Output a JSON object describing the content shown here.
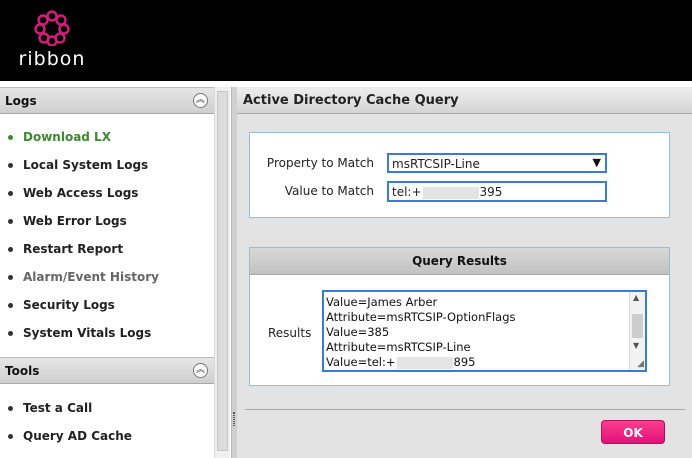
{
  "brand": {
    "name": "ribbon",
    "accent": "#e0127a"
  },
  "sidebar": {
    "sections": [
      {
        "title": "Logs",
        "items": [
          {
            "label": "Download LX",
            "state": "active"
          },
          {
            "label": "Local System Logs",
            "state": ""
          },
          {
            "label": "Web Access Logs",
            "state": ""
          },
          {
            "label": "Web Error Logs",
            "state": ""
          },
          {
            "label": "Restart Report",
            "state": ""
          },
          {
            "label": "Alarm/Event History",
            "state": "muted"
          },
          {
            "label": "Security Logs",
            "state": ""
          },
          {
            "label": "System Vitals Logs",
            "state": ""
          }
        ]
      },
      {
        "title": "Tools",
        "items": [
          {
            "label": "Test a Call",
            "state": ""
          },
          {
            "label": "Query AD Cache",
            "state": ""
          }
        ]
      }
    ]
  },
  "main": {
    "title": "Active Directory Cache Query",
    "property_label": "Property to Match",
    "property_value": "msRTCSIP-Line",
    "value_label": "Value to Match",
    "value_prefix": "tel:+",
    "value_suffix": "395",
    "results_title": "Query Results",
    "results_label": "Results",
    "results_lines": [
      "Value=James Arber",
      "Attribute=msRTCSIP-OptionFlags",
      "Value=385",
      "Attribute=msRTCSIP-Line"
    ],
    "results_last_prefix": "Value=tel:+",
    "results_last_suffix": "895",
    "ok_label": "OK"
  }
}
